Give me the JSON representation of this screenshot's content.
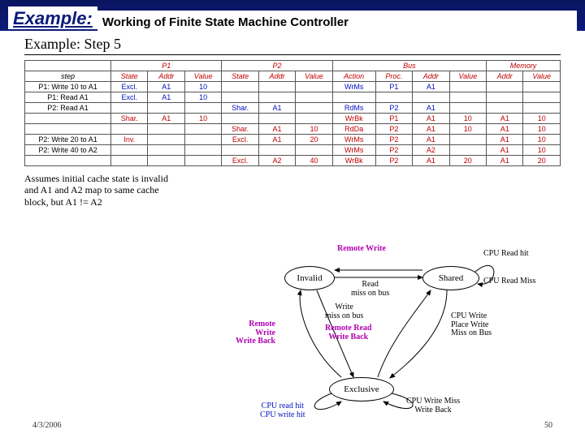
{
  "title": {
    "example": "Example:",
    "rest": "Working of Finite State Machine Controller"
  },
  "step_heading": "Example: Step 5",
  "groups": {
    "p1": "P1",
    "p2": "P2",
    "bus": "Bus",
    "memory": "Memory"
  },
  "cols": {
    "step": "step",
    "state": "State",
    "addr": "Addr",
    "value": "Value",
    "action": "Action",
    "proc": "Proc."
  },
  "rows": [
    {
      "step": "P1: Write 10 to A1",
      "p1_state": "Excl.",
      "p1_addr": "A1",
      "p1_val": "10",
      "bus_action": "WrMs",
      "bus_proc": "P1",
      "bus_addr": "A1"
    },
    {
      "step": "P1: Read A1",
      "p1_state": "Excl.",
      "p1_addr": "A1",
      "p1_val": "10"
    },
    {
      "step": "P2: Read A1",
      "p2_state": "Shar.",
      "p2_addr": "A1",
      "bus_action": "RdMs",
      "bus_proc": "P2",
      "bus_addr": "A1"
    },
    {
      "p1_state": "Shar.",
      "p1_addr": "A1",
      "p1_val": "10",
      "bus_action": "WrBk",
      "bus_proc": "P1",
      "bus_addr": "A1",
      "bus_val": "10",
      "mem_addr": "A1",
      "mem_val": "10"
    },
    {
      "p2_state": "Shar.",
      "p2_addr": "A1",
      "p2_val": "10",
      "bus_action": "RdDa",
      "bus_proc": "P2",
      "bus_addr": "A1",
      "bus_val": "10",
      "mem_addr": "A1",
      "mem_val": "10"
    },
    {
      "step": "P2: Write 20 to A1",
      "p1_state": "Inv.",
      "p2_state": "Excl.",
      "p2_addr": "A1",
      "p2_val": "20",
      "bus_action": "WrMs",
      "bus_proc": "P2",
      "bus_addr": "A1",
      "mem_addr": "A1",
      "mem_val": "10"
    },
    {
      "step": "P2: Write 40 to A2",
      "bus_action": "WrMs",
      "bus_proc": "P2",
      "bus_addr": "A2",
      "mem_addr": "A1",
      "mem_val": "10"
    },
    {
      "p2_state": "Excl.",
      "p2_addr": "A2",
      "p2_val": "40",
      "bus_action": "WrBk",
      "bus_proc": "P2",
      "bus_addr": "A1",
      "bus_val": "20",
      "mem_addr": "A1",
      "mem_val": "20"
    }
  ],
  "assume": "Assumes initial cache state is invalid and A1 and A2 map to same cache block, but A1 != A2",
  "states": {
    "invalid": "Invalid",
    "shared": "Shared",
    "exclusive": "Exclusive"
  },
  "labels": {
    "remote_write_top": "Remote Write",
    "cpu_read_hit": "CPU Read hit",
    "cpu_read_miss": "CPU Read Miss",
    "read_miss_bus": "Read\nmiss on bus",
    "write_miss_bus": "Write\nmiss on bus",
    "remote_read_wb": "Remote Read\nWrite Back",
    "remote_write_wb": "Remote\nWrite\nWrite Back",
    "cpu_write_place": "CPU Write\nPlace Write\nMiss on Bus",
    "cpu_read_write_hit": "CPU read hit\nCPU write hit",
    "cpu_write_miss_wb": "CPU Write Miss\nWrite Back"
  },
  "footer": {
    "date": "4/3/2006",
    "page": "50"
  }
}
